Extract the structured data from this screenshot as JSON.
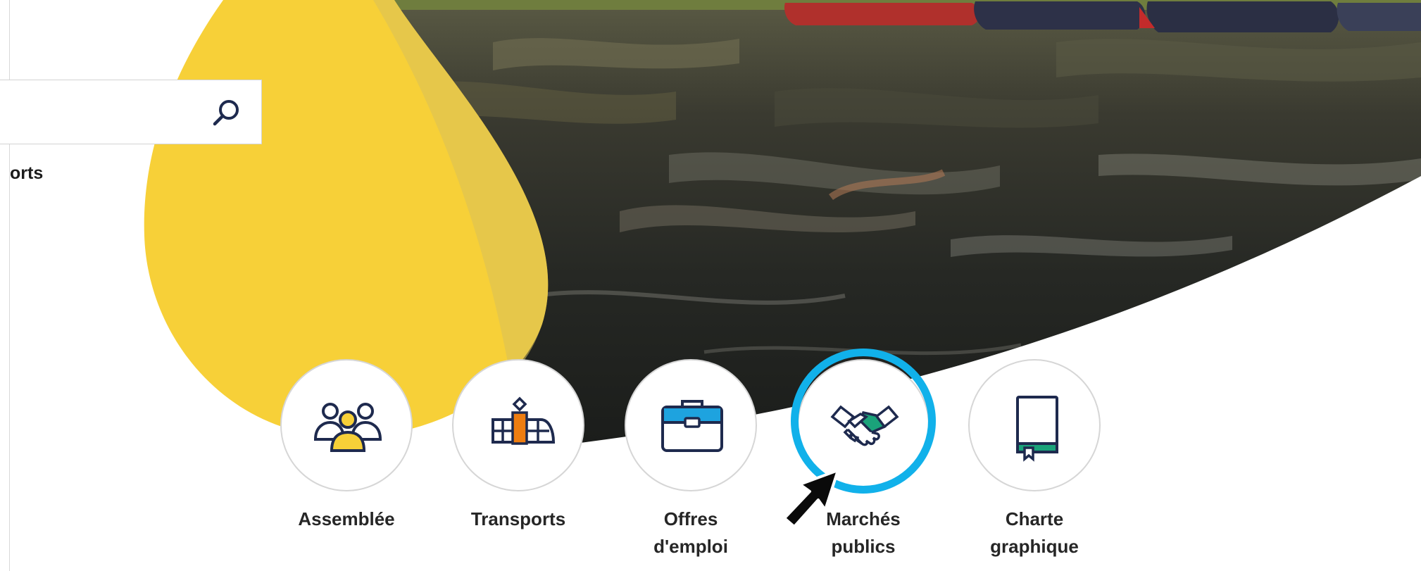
{
  "search": {
    "placeholder": "",
    "value": "",
    "icon": "search-icon"
  },
  "nav": {
    "fragment": "orts"
  },
  "quick_links": [
    {
      "label_lines": [
        "Assemblée"
      ],
      "icon": "people-group-icon"
    },
    {
      "label_lines": [
        "Transports"
      ],
      "icon": "tram-icon"
    },
    {
      "label_lines": [
        "Offres",
        "d'emploi"
      ],
      "icon": "briefcase-icon"
    },
    {
      "label_lines": [
        "Marchés",
        "publics"
      ],
      "icon": "handshake-icon"
    },
    {
      "label_lines": [
        "Charte",
        "graphique"
      ],
      "icon": "book-icon"
    }
  ],
  "highlighted_link": "Marchés publics",
  "colors": {
    "brand_yellow": "#f7d038",
    "navy": "#1e2a4e",
    "accent_orange": "#ee7d10",
    "accent_blue": "#1ea3df",
    "accent_green": "#1aa37a",
    "highlight_ring": "#11b1ea"
  }
}
